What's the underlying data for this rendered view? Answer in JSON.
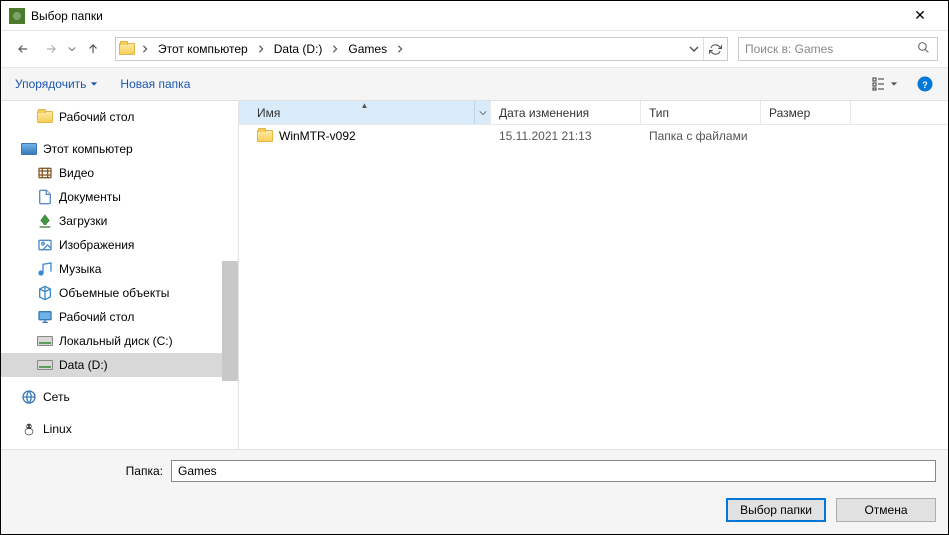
{
  "window": {
    "title": "Выбор папки"
  },
  "nav": {
    "breadcrumbs": [
      "Этот компьютер",
      "Data (D:)",
      "Games"
    ]
  },
  "search": {
    "placeholder": "Поиск в: Games"
  },
  "toolbar": {
    "organize": "Упорядочить",
    "new_folder": "Новая папка"
  },
  "sidebar": {
    "desktop": "Рабочий стол",
    "this_pc": "Этот компьютер",
    "children": [
      {
        "label": "Видео",
        "icon": "video"
      },
      {
        "label": "Документы",
        "icon": "docs"
      },
      {
        "label": "Загрузки",
        "icon": "downloads"
      },
      {
        "label": "Изображения",
        "icon": "images"
      },
      {
        "label": "Музыка",
        "icon": "music"
      },
      {
        "label": "Объемные объекты",
        "icon": "3d"
      },
      {
        "label": "Рабочий стол",
        "icon": "desk"
      },
      {
        "label": "Локальный диск (C:)",
        "icon": "disk"
      },
      {
        "label": "Data (D:)",
        "icon": "disk",
        "selected": true
      }
    ],
    "network": "Сеть",
    "linux": "Linux"
  },
  "columns": {
    "name": "Имя",
    "date": "Дата изменения",
    "type": "Тип",
    "size": "Размер"
  },
  "files": [
    {
      "name": "WinMTR-v092",
      "date": "15.11.2021 21:13",
      "type": "Папка с файлами",
      "size": ""
    }
  ],
  "footer": {
    "label": "Папка:",
    "value": "Games",
    "select": "Выбор папки",
    "cancel": "Отмена"
  }
}
